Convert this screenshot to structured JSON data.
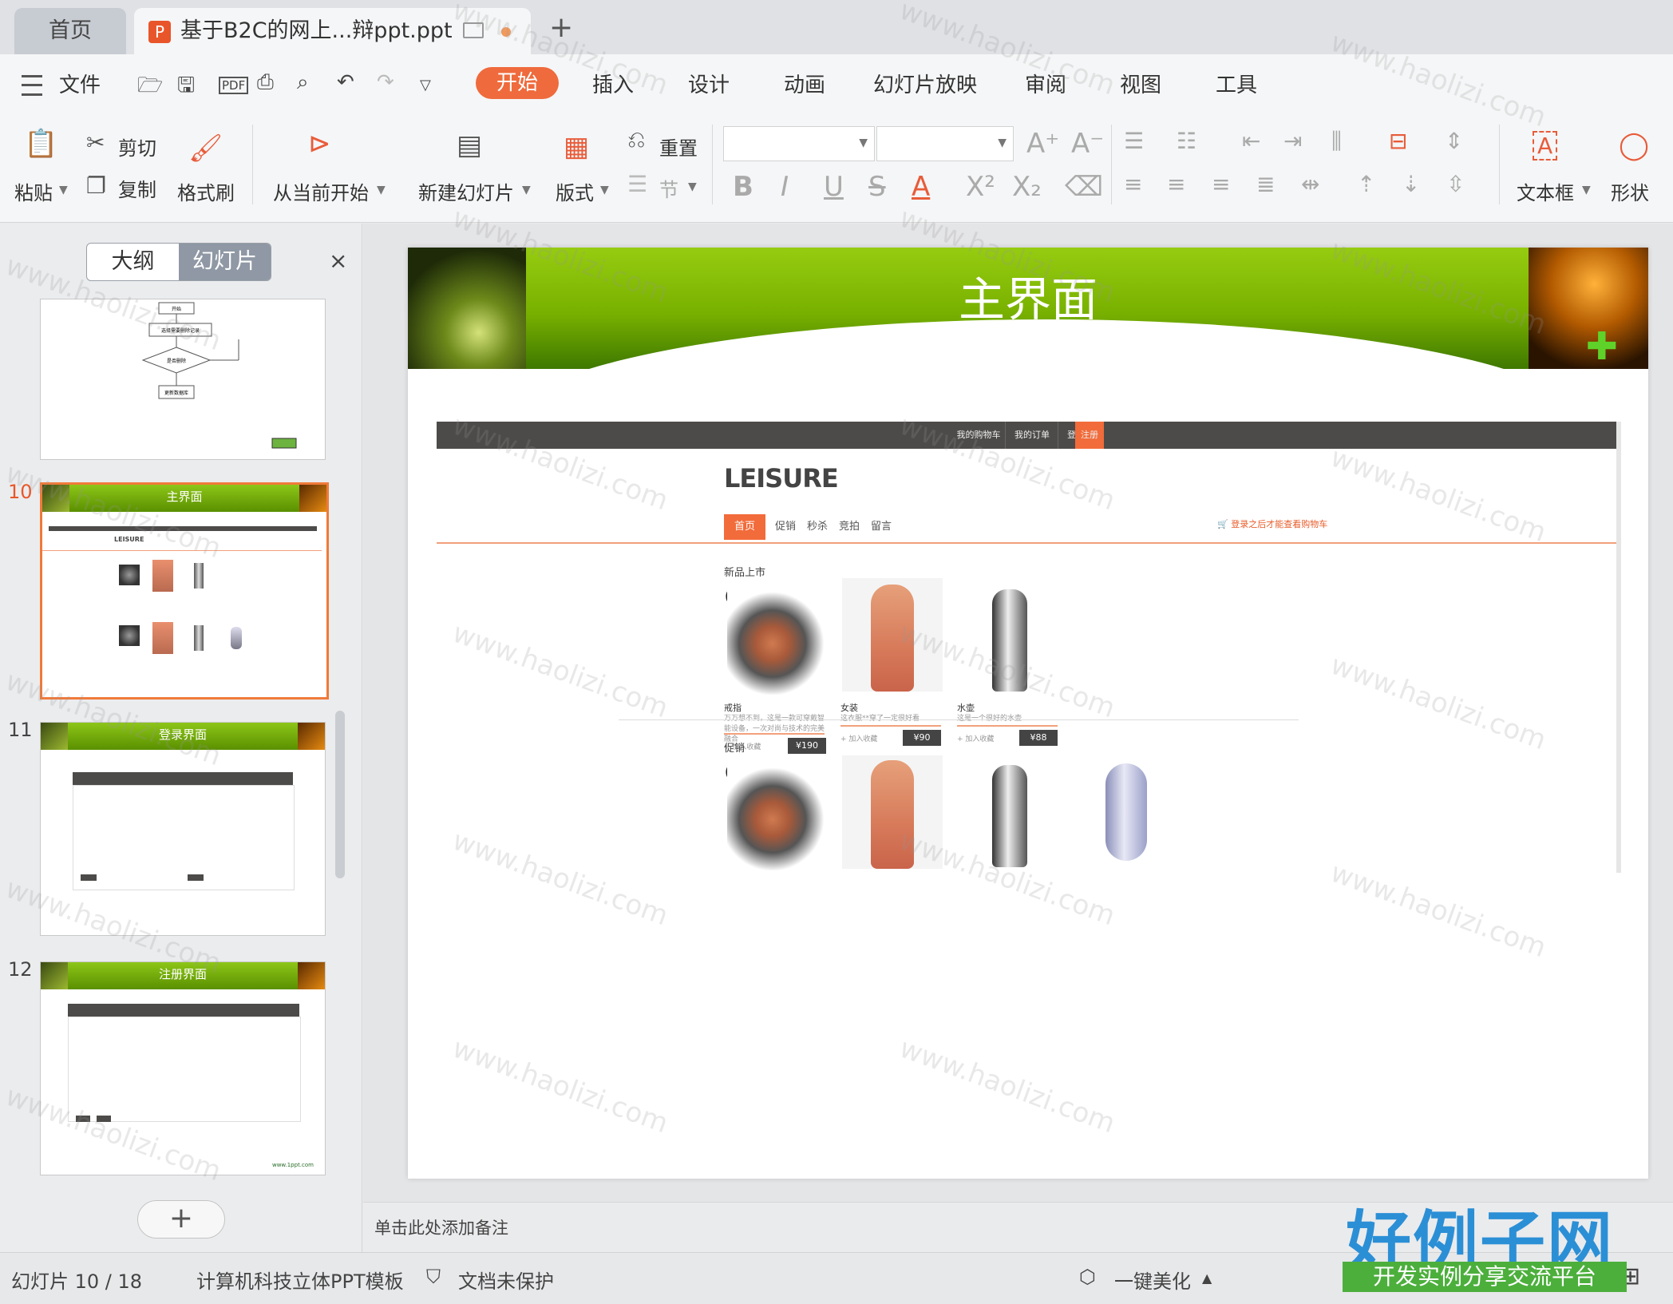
{
  "tabs": {
    "home": "首页",
    "doc": "基于B2C的网上...辩ppt.ppt",
    "add": "+"
  },
  "menu": {
    "file": "文件",
    "items": [
      "开始",
      "插入",
      "设计",
      "动画",
      "幻灯片放映",
      "审阅",
      "视图",
      "工具"
    ]
  },
  "ribbon": {
    "paste": "粘贴",
    "cut": "剪切",
    "copy": "复制",
    "format_painter": "格式刷",
    "from_current": "从当前开始",
    "new_slide": "新建幻灯片",
    "layout": "版式",
    "reset": "重置",
    "section": "节",
    "textbox": "文本框",
    "shape": "形状",
    "bold": "B",
    "italic": "I",
    "underline": "U",
    "strike": "S",
    "font_color": "A"
  },
  "left_pane": {
    "outline_tab": "大纲",
    "slides_tab": "幻灯片",
    "close": "×",
    "add": "+",
    "thumbnails": [
      {
        "num": "",
        "title": "",
        "flow": [
          "开始",
          "选择需要删除记录",
          "是否删除",
          "更新数据库"
        ]
      },
      {
        "num": "10",
        "title": "主界面",
        "selected": true
      },
      {
        "num": "11",
        "title": "登录界面",
        "selected": false
      },
      {
        "num": "12",
        "title": "注册界面",
        "selected": false,
        "footer": "www.1ppt.com"
      }
    ]
  },
  "slide": {
    "title": "主界面",
    "site": {
      "topnav": [
        "我的购物车",
        "我的订单",
        "登录",
        "注册"
      ],
      "logo": "LEISURE",
      "nav": [
        "首页",
        "促销",
        "秒杀",
        "竞拍",
        "留言"
      ],
      "cart_hint": "登录之后才能查看购物车",
      "new_title": "新品上市",
      "promo_title": "促销",
      "fav": "+ 加入收藏",
      "products": [
        {
          "name": "戒指",
          "desc": "万万想不到，这是一款可穿戴智能设备，一次对尚与技术的完美融合",
          "price": "¥190"
        },
        {
          "name": "女装",
          "desc": "这衣服**穿了一定很好看",
          "price": "¥90"
        },
        {
          "name": "水壶",
          "desc": "这是一个很好的水壶",
          "price": "¥88"
        }
      ]
    }
  },
  "notes": "单击此处添加备注",
  "status": {
    "slide_counter": "幻灯片 10 / 18",
    "template": "计算机科技立体PPT模板",
    "protect": "文档未保护",
    "beautify": "一键美化"
  },
  "watermark": {
    "text": "www.haolizi.com",
    "logo": "好例子网",
    "logo_sub": "开发实例分享交流平台"
  },
  "colors": {
    "accent": "#ef6a3c",
    "slide_green": "#78b000",
    "site_dark": "#4d4b49"
  }
}
